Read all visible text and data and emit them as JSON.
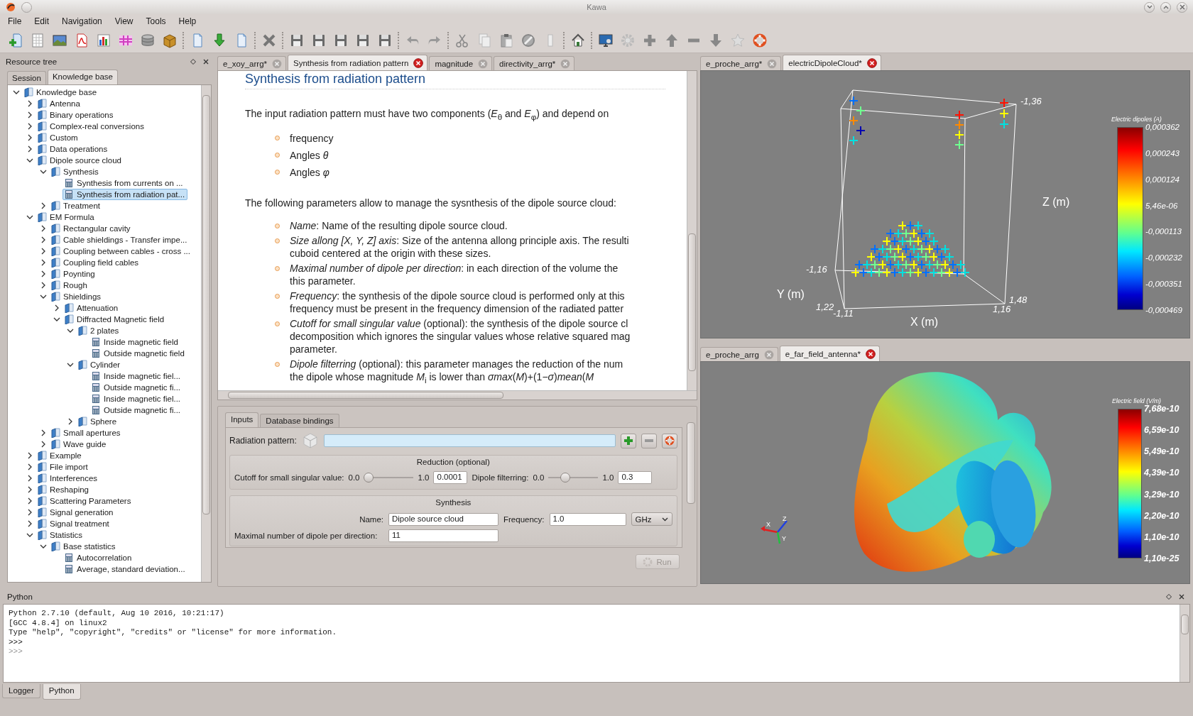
{
  "window": {
    "title": "Kawa"
  },
  "menu": [
    "File",
    "Edit",
    "Navigation",
    "View",
    "Tools",
    "Help"
  ],
  "toolbar": [
    {
      "kind": "new-item"
    },
    {
      "kind": "spreadsheet"
    },
    {
      "kind": "image"
    },
    {
      "kind": "pdf"
    },
    {
      "kind": "bar-chart"
    },
    {
      "kind": "grid"
    },
    {
      "kind": "database"
    },
    {
      "kind": "package"
    },
    {
      "kind": "separator"
    },
    {
      "kind": "document"
    },
    {
      "kind": "download"
    },
    {
      "kind": "document"
    },
    {
      "kind": "separator"
    },
    {
      "kind": "delete"
    },
    {
      "kind": "separator"
    },
    {
      "kind": "save"
    },
    {
      "kind": "save"
    },
    {
      "kind": "save"
    },
    {
      "kind": "save"
    },
    {
      "kind": "save"
    },
    {
      "kind": "separator"
    },
    {
      "kind": "undo"
    },
    {
      "kind": "redo"
    },
    {
      "kind": "separator"
    },
    {
      "kind": "cut"
    },
    {
      "kind": "copy"
    },
    {
      "kind": "paste"
    },
    {
      "kind": "block"
    },
    {
      "kind": "column"
    },
    {
      "kind": "separator"
    },
    {
      "kind": "home"
    },
    {
      "kind": "separator"
    },
    {
      "kind": "monitor"
    },
    {
      "kind": "gear"
    },
    {
      "kind": "plus"
    },
    {
      "kind": "up"
    },
    {
      "kind": "minus"
    },
    {
      "kind": "down"
    },
    {
      "kind": "star"
    },
    {
      "kind": "lifebuoy"
    }
  ],
  "resource_tree": {
    "title": "Resource tree",
    "tabs": [
      {
        "label": "Session",
        "selected": false
      },
      {
        "label": "Knowledge base",
        "selected": true
      }
    ],
    "items": [
      {
        "label": "Knowledge base",
        "kind": "folder",
        "expanded": true,
        "selected": false,
        "children": [
          {
            "label": "Antenna",
            "kind": "folder",
            "expanded": false,
            "selected": false
          },
          {
            "label": "Binary operations",
            "kind": "folder",
            "expanded": false,
            "selected": false
          },
          {
            "label": "Complex-real conversions",
            "kind": "folder",
            "expanded": false,
            "selected": false
          },
          {
            "label": "Custom",
            "kind": "folder",
            "expanded": false,
            "selected": false
          },
          {
            "label": "Data operations",
            "kind": "folder",
            "expanded": false,
            "selected": false
          },
          {
            "label": "Dipole source cloud",
            "kind": "folder",
            "expanded": true,
            "selected": false,
            "children": [
              {
                "label": "Synthesis",
                "kind": "folder",
                "expanded": true,
                "selected": false,
                "children": [
                  {
                    "label": "Synthesis from currents on ...",
                    "kind": "function",
                    "selected": false
                  },
                  {
                    "label": "Synthesis from radiation pat...",
                    "kind": "function",
                    "selected": true
                  }
                ]
              },
              {
                "label": "Treatment",
                "kind": "folder",
                "expanded": false,
                "selected": false
              }
            ]
          },
          {
            "label": "EM Formula",
            "kind": "folder",
            "expanded": true,
            "selected": false,
            "children": [
              {
                "label": "Rectangular cavity",
                "kind": "folder",
                "expanded": false,
                "selected": false
              },
              {
                "label": "Cable shieldings - Transfer impe...",
                "kind": "folder",
                "expanded": false,
                "selected": false
              },
              {
                "label": "Coupling between cables - cross ...",
                "kind": "folder",
                "expanded": false,
                "selected": false
              },
              {
                "label": "Coupling field cables",
                "kind": "folder",
                "expanded": false,
                "selected": false
              },
              {
                "label": "Poynting",
                "kind": "folder",
                "expanded": false,
                "selected": false
              },
              {
                "label": "Rough",
                "kind": "folder",
                "expanded": false,
                "selected": false
              },
              {
                "label": "Shieldings",
                "kind": "folder",
                "expanded": true,
                "selected": false,
                "children": [
                  {
                    "label": "Attenuation",
                    "kind": "folder",
                    "expanded": false,
                    "selected": false
                  },
                  {
                    "label": "Diffracted Magnetic field",
                    "kind": "folder",
                    "expanded": true,
                    "selected": false,
                    "children": [
                      {
                        "label": "2 plates",
                        "kind": "folder",
                        "expanded": true,
                        "selected": false,
                        "children": [
                          {
                            "label": "Inside magnetic field",
                            "kind": "function",
                            "selected": false
                          },
                          {
                            "label": "Outside magnetic field",
                            "kind": "function",
                            "selected": false
                          }
                        ]
                      },
                      {
                        "label": "Cylinder",
                        "kind": "folder",
                        "expanded": true,
                        "selected": false,
                        "children": [
                          {
                            "label": "Inside magnetic fiel...",
                            "kind": "function",
                            "selected": false
                          },
                          {
                            "label": "Outside magnetic fi...",
                            "kind": "function",
                            "selected": false
                          },
                          {
                            "label": "Inside magnetic fiel...",
                            "kind": "function",
                            "selected": false
                          },
                          {
                            "label": "Outside magnetic fi...",
                            "kind": "function",
                            "selected": false
                          }
                        ]
                      },
                      {
                        "label": "Sphere",
                        "kind": "folder",
                        "expanded": false,
                        "selected": false
                      }
                    ]
                  }
                ]
              },
              {
                "label": "Small apertures",
                "kind": "folder",
                "expanded": false,
                "selected": false
              },
              {
                "label": "Wave guide",
                "kind": "folder",
                "expanded": false,
                "selected": false
              }
            ]
          },
          {
            "label": "Example",
            "kind": "folder",
            "expanded": false,
            "selected": false
          },
          {
            "label": "File import",
            "kind": "folder",
            "expanded": false,
            "selected": false
          },
          {
            "label": "Interferences",
            "kind": "folder",
            "expanded": false,
            "selected": false
          },
          {
            "label": "Reshaping",
            "kind": "folder",
            "expanded": false,
            "selected": false
          },
          {
            "label": "Scattering Parameters",
            "kind": "folder",
            "expanded": false,
            "selected": false
          },
          {
            "label": "Signal generation",
            "kind": "folder",
            "expanded": false,
            "selected": false
          },
          {
            "label": "Signal treatment",
            "kind": "folder",
            "expanded": false,
            "selected": false
          },
          {
            "label": "Statistics",
            "kind": "folder",
            "expanded": true,
            "selected": false,
            "children": [
              {
                "label": "Base statistics",
                "kind": "folder",
                "expanded": true,
                "selected": false,
                "children": [
                  {
                    "label": "Autocorrelation",
                    "kind": "function",
                    "selected": false
                  },
                  {
                    "label": "Average, standard deviation...",
                    "kind": "function",
                    "selected": false
                  }
                ]
              }
            ]
          }
        ]
      }
    ]
  },
  "document": {
    "tabs": [
      {
        "label": "e_xoy_arrg*",
        "selected": false
      },
      {
        "label": "Synthesis from radiation pattern",
        "selected": true
      },
      {
        "label": "magnitude",
        "selected": false
      },
      {
        "label": "directivity_arrg*",
        "selected": false
      }
    ],
    "heading": "Synthesis from radiation pattern",
    "intro": "The input radiation pattern must have two components (*E*$_{θ}$ and *E*$_{φ}$) and depend on",
    "dependencies": [
      "frequency",
      "Angles *θ*",
      "Angles *φ*"
    ],
    "parameters_intro": "The following parameters allow to manage the sysnthesis of the dipole source cloud:",
    "parameters": [
      {
        "lines": [
          "*Name*: Name of the resulting dipole source cloud."
        ]
      },
      {
        "lines": [
          "*Size allong [X, Y, Z] axis*: Size of the antenna allong principle axis. The resulti",
          "cuboid centered at the origin with these sizes."
        ]
      },
      {
        "lines": [
          "*Maximal number of dipole per direction*: in each direction of the volume the",
          "this parameter."
        ]
      },
      {
        "lines": [
          "*Frequency*: the synthesis of the dipole source cloud is performed only at this",
          "frequency must be present in the frequency dimension of the radiated patter"
        ]
      },
      {
        "lines": [
          "*Cutoff for small singular value* (optional): the synthesis of the dipole source cl",
          "decomposition which ignores the singular values whose relative squared mag",
          "parameter."
        ]
      },
      {
        "lines": [
          "*Dipole filterring* (optional): this parameter manages the reduction of the num",
          "the dipole whose magnitude *M*$_{i}$ is lower than *σmax*(*M*)+(1−*σ*)*mean*(*M*"
        ]
      }
    ]
  },
  "inputs": {
    "tabs": [
      {
        "label": "Inputs",
        "selected": true
      },
      {
        "label": "Database bindings",
        "selected": false
      }
    ],
    "radiation_pattern": {
      "label": "Radiation pattern:"
    },
    "reduction": {
      "title": "Reduction (optional)",
      "cutoff": {
        "label": "Cutoff for small singular value:",
        "min": "0.0",
        "max": "1.0",
        "level": 0,
        "value": "0.0001"
      },
      "filtering": {
        "label": "Dipole filterring:",
        "min": "0.0",
        "max": "1.0",
        "level": 0.3,
        "value": "0.3"
      }
    },
    "synthesis": {
      "title": "Synthesis",
      "name": {
        "label": "Name:",
        "value": "Dipole source cloud"
      },
      "frequency": {
        "label": "Frequency:",
        "value": "1.0",
        "unit": "GHz"
      },
      "max_dipoles": {
        "label": "Maximal number of dipole per direction:",
        "value": "11"
      }
    },
    "run": {
      "label": "Run",
      "disabled": true
    }
  },
  "views": [
    {
      "kind": "dipole-cloud",
      "tabs": [
        {
          "label": "e_proche_arrg*",
          "selected": false
        },
        {
          "label": "electricDipoleCloud*",
          "selected": true
        }
      ],
      "axis_labels": [
        "-1,36",
        "Z (m)",
        "-1,16",
        "Y (m)",
        "1,22",
        "-1,11",
        "X (m)",
        "1,48",
        "1,16"
      ],
      "colorbar": {
        "title": "Electric dipoles (A)",
        "labels": [
          "0,000362",
          "0,000243",
          "0,000124",
          "5,46e-06",
          "-0,000113",
          "-0,000232",
          "-0,000351",
          "-0,000469"
        ]
      }
    },
    {
      "kind": "far-field",
      "tabs": [
        {
          "label": "e_proche_arrg",
          "selected": false
        },
        {
          "label": "e_far_field_antenna*",
          "selected": true
        }
      ],
      "axis_labels": [
        "X",
        "Z",
        "Y"
      ],
      "colorbar": {
        "title": "Electric field (V/m)",
        "labels": [
          "7,68e-10",
          "6,59e-10",
          "5,49e-10",
          "4,39e-10",
          "3,29e-10",
          "2,20e-10",
          "1,10e-10",
          "1,10e-25"
        ]
      }
    }
  ],
  "console": {
    "title": "Python",
    "lines": [
      {
        "text": "Python 2.7.10 (default, Aug 10 2016, 10:21:17)",
        "kind": "output"
      },
      {
        "text": "[GCC 4.8.4] on linux2",
        "kind": "output"
      },
      {
        "text": "Type \"help\", \"copyright\", \"credits\" or \"license\" for more information.",
        "kind": "output"
      },
      {
        "text": ">>>",
        "kind": "output"
      },
      {
        "text": ">>>",
        "kind": "input"
      }
    ]
  },
  "bottom_tabs": [
    {
      "label": "Logger",
      "selected": false
    },
    {
      "label": "Python",
      "selected": true
    }
  ]
}
